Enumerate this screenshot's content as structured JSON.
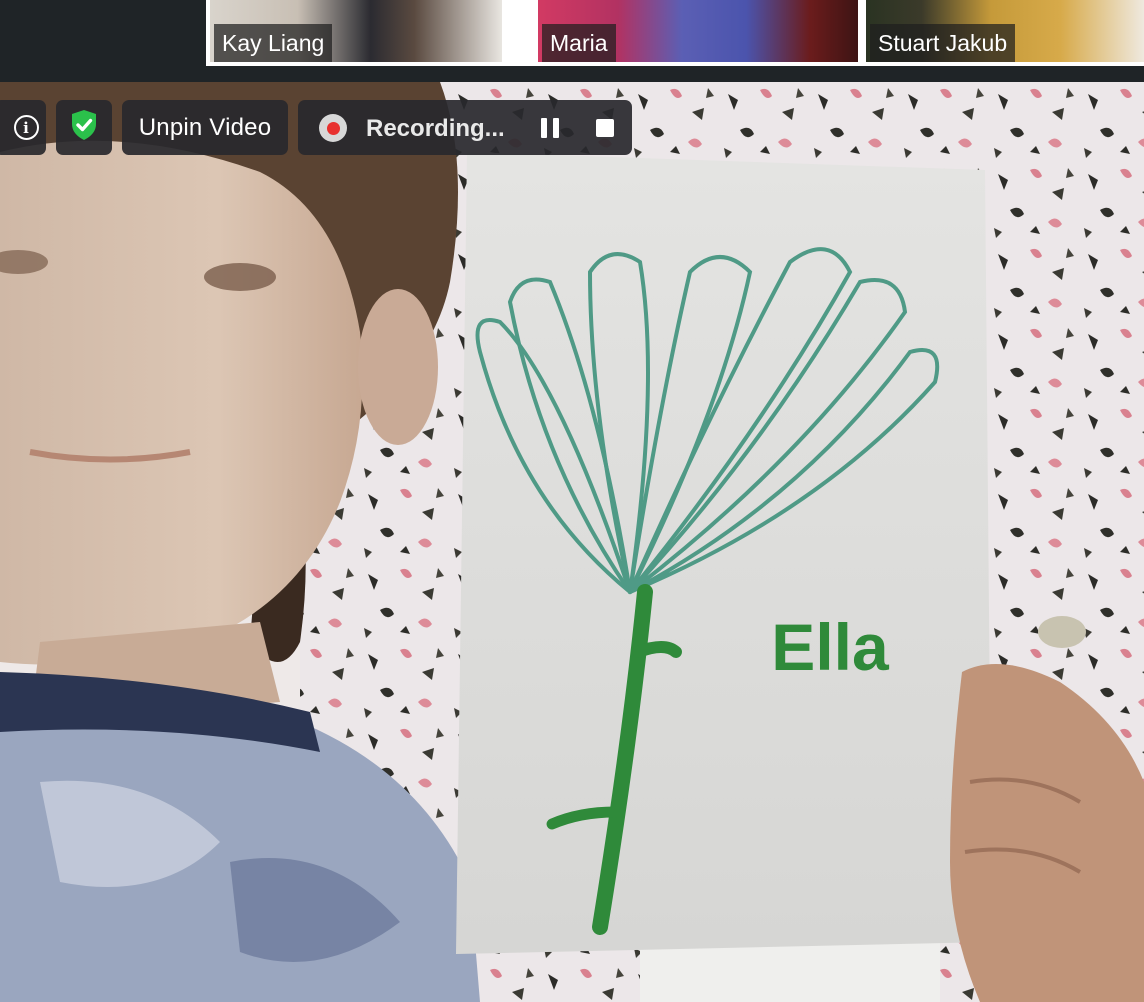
{
  "participants": [
    {
      "name": "Kay Liang"
    },
    {
      "name": "Maria"
    },
    {
      "name": "Stuart Jakub"
    }
  ],
  "controls": {
    "info_icon": "info-icon",
    "info_glyph": "i",
    "security_icon": "shield-check-icon",
    "unpin_label": "Unpin Video",
    "recording_label": "Recording...",
    "pause_icon": "pause-icon",
    "stop_icon": "stop-icon"
  },
  "main_video": {
    "paper_text": "Ella"
  },
  "colors": {
    "recording_red": "#e8312f",
    "shield_green": "#2bc14b",
    "drawing_green": "#2f8a3a"
  }
}
